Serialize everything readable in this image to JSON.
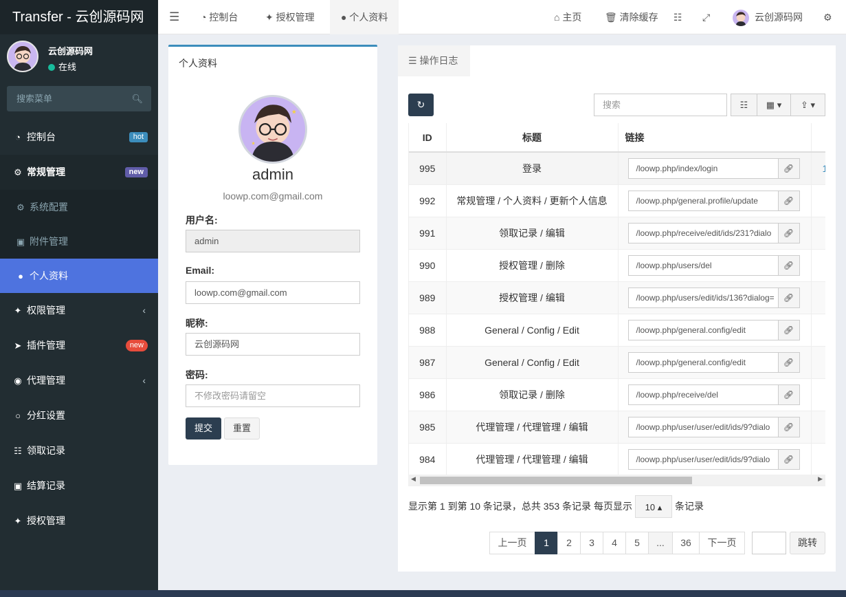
{
  "brand": "Transfer - 云创源码网",
  "user": {
    "name": "云创源码网",
    "status": "在线"
  },
  "search": {
    "placeholder": "搜索菜单"
  },
  "menu": [
    {
      "label": "控制台",
      "badge": "hot"
    },
    {
      "label": "常规管理",
      "badge": "new"
    },
    {
      "label": "系统配置"
    },
    {
      "label": "附件管理"
    },
    {
      "label": "个人资料"
    },
    {
      "label": "权限管理"
    },
    {
      "label": "插件管理",
      "badge": "new"
    },
    {
      "label": "代理管理"
    },
    {
      "label": "分红设置"
    },
    {
      "label": "领取记录"
    },
    {
      "label": "结算记录"
    },
    {
      "label": "授权管理"
    }
  ],
  "topnav": {
    "tabs": [
      "控制台",
      "授权管理",
      "个人资料"
    ],
    "home": "主页",
    "clear_cache": "清除缓存",
    "username": "云创源码网"
  },
  "profile": {
    "title": "个人资料",
    "username": "admin",
    "email": "loowp.com@gmail.com",
    "fields": {
      "username_label": "用户名:",
      "username_value": "admin",
      "email_label": "Email:",
      "email_value": "loowp.com@gmail.com",
      "nickname_label": "昵称:",
      "nickname_value": "云创源码网",
      "password_label": "密码:",
      "password_placeholder": "不修改密码请留空"
    },
    "submit": "提交",
    "reset": "重置"
  },
  "log": {
    "tab": "操作日志",
    "search_placeholder": "搜索",
    "columns": [
      "ID",
      "标题",
      "链接"
    ],
    "rows": [
      {
        "id": "995",
        "title": "登录",
        "url": "/loowp.php/index/login"
      },
      {
        "id": "992",
        "title": "常规管理 / 个人资料 / 更新个人信息",
        "url": "/loowp.php/general.profile/update"
      },
      {
        "id": "991",
        "title": "领取记录 / 编辑",
        "url": "/loowp.php/receive/edit/ids/231?dialo"
      },
      {
        "id": "990",
        "title": "授权管理 / 删除",
        "url": "/loowp.php/users/del"
      },
      {
        "id": "989",
        "title": "授权管理 / 编辑",
        "url": "/loowp.php/users/edit/ids/136?dialog="
      },
      {
        "id": "988",
        "title": "General / Config / Edit",
        "url": "/loowp.php/general.config/edit"
      },
      {
        "id": "987",
        "title": "General / Config / Edit",
        "url": "/loowp.php/general.config/edit"
      },
      {
        "id": "986",
        "title": "领取记录 / 删除",
        "url": "/loowp.php/receive/del"
      },
      {
        "id": "985",
        "title": "代理管理 / 代理管理 / 编辑",
        "url": "/loowp.php/user/user/edit/ids/9?dialo"
      },
      {
        "id": "984",
        "title": "代理管理 / 代理管理 / 编辑",
        "url": "/loowp.php/user/user/edit/ids/9?dialo"
      }
    ],
    "overflow_cell": "1",
    "pageinfo_before": "显示第 1 到第 10 条记录，总共 353 条记录 每页显示",
    "pagesize": "10",
    "pageinfo_after": "条记录",
    "pager": {
      "prev": "上一页",
      "pages": [
        "1",
        "2",
        "3",
        "4",
        "5",
        "...",
        "36"
      ],
      "next": "下一页"
    },
    "jump": "跳转"
  },
  "colors": {
    "sidebar": "#222d32",
    "active": "#4e73df",
    "primary": "#2c3e50",
    "hot": "#3c8dbc",
    "new_purple": "#605ca8",
    "new_red": "#e74c3c"
  }
}
